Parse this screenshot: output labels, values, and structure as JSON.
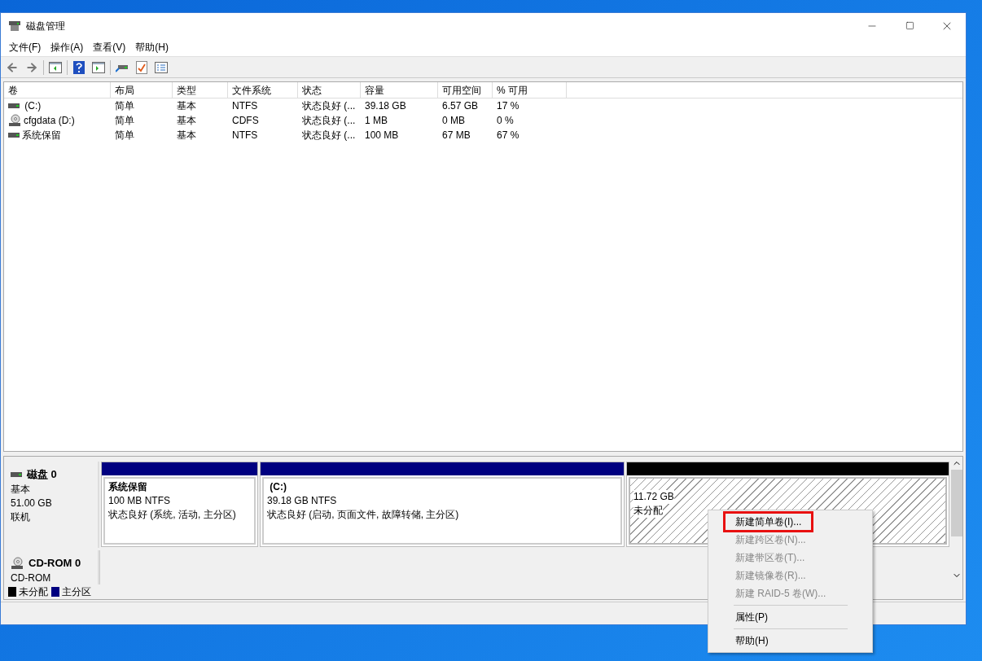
{
  "window": {
    "title": "磁盘管理"
  },
  "menu_bar": [
    "文件(F)",
    "操作(A)",
    "查看(V)",
    "帮助(H)"
  ],
  "volume_table": {
    "columns": [
      "卷",
      "布局",
      "类型",
      "文件系统",
      "状态",
      "容量",
      "可用空间",
      "% 可用"
    ],
    "rows": [
      {
        "kind": "disk",
        "cells": [
          " (C:)",
          "简单",
          "基本",
          "NTFS",
          "状态良好 (...",
          "39.18 GB",
          "6.57 GB",
          "17 %"
        ]
      },
      {
        "kind": "cd",
        "cells": [
          "cfgdata (D:)",
          "简单",
          "基本",
          "CDFS",
          "状态良好 (...",
          "1 MB",
          "0 MB",
          "0 %"
        ]
      },
      {
        "kind": "disk",
        "cells": [
          "系统保留",
          "简单",
          "基本",
          "NTFS",
          "状态良好 (...",
          "100 MB",
          "67 MB",
          "67 %"
        ]
      }
    ]
  },
  "disks": [
    {
      "kind": "disk",
      "name": "磁盘 0",
      "lines": [
        "基本",
        "51.00 GB",
        "联机"
      ],
      "partitions": [
        {
          "kind": "primary",
          "name": "系统保留",
          "lines": [
            "100 MB NTFS",
            "状态良好 (系统, 活动, 主分区)"
          ]
        },
        {
          "kind": "primary",
          "name": " (C:)",
          "lines": [
            "39.18 GB NTFS",
            "状态良好 (启动, 页面文件, 故障转储, 主分区)"
          ]
        },
        {
          "kind": "unallocated",
          "lines": [
            "11.72 GB",
            "未分配"
          ]
        }
      ]
    },
    {
      "kind": "cd",
      "name": "CD-ROM 0",
      "lines": [
        "CD-ROM"
      ]
    }
  ],
  "legend": [
    {
      "label": "未分配",
      "color": "#000000"
    },
    {
      "label": "主分区",
      "color": "#000080"
    }
  ],
  "context_menu": [
    {
      "kind": "item",
      "label": "新建简单卷(I)...",
      "disabled": false,
      "outlined": true
    },
    {
      "kind": "item",
      "label": "新建跨区卷(N)...",
      "disabled": true,
      "outlined": false
    },
    {
      "kind": "item",
      "label": "新建带区卷(T)...",
      "disabled": true,
      "outlined": false
    },
    {
      "kind": "item",
      "label": "新建镜像卷(R)...",
      "disabled": true,
      "outlined": false
    },
    {
      "kind": "item",
      "label": "新建 RAID-5 卷(W)...",
      "disabled": true,
      "outlined": false
    },
    {
      "kind": "separator"
    },
    {
      "kind": "item",
      "label": "属性(P)",
      "disabled": false,
      "outlined": false
    },
    {
      "kind": "separator"
    },
    {
      "kind": "item",
      "label": "帮助(H)",
      "disabled": false,
      "outlined": false
    }
  ]
}
